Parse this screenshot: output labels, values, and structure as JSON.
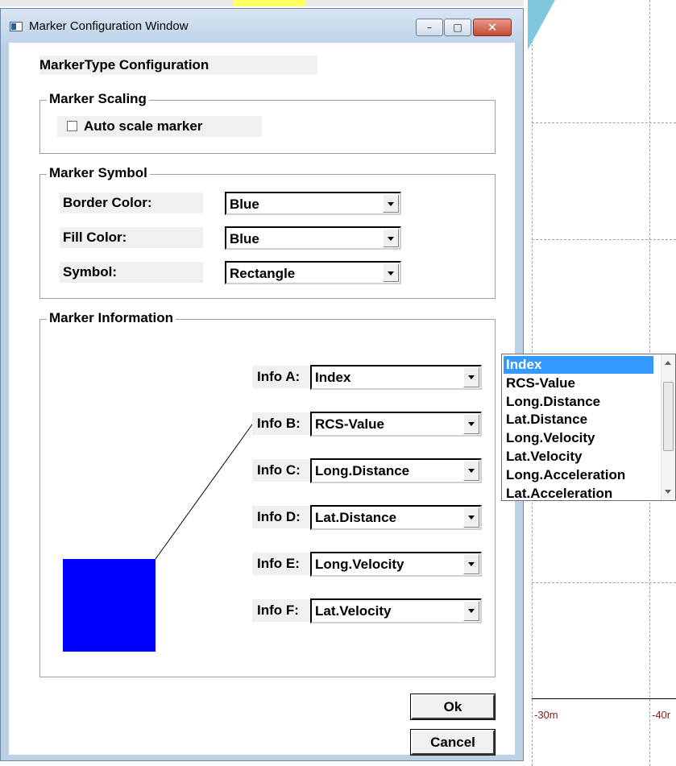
{
  "window": {
    "title": "Marker Configuration Window",
    "heading": "MarkerType Configuration",
    "controls": {
      "minimize": "–",
      "maximize": "□",
      "close": "✕"
    }
  },
  "marker_scaling": {
    "legend": "Marker Scaling",
    "auto_scale_label": "Auto scale marker",
    "auto_scale_checked": false
  },
  "marker_symbol": {
    "legend": "Marker Symbol",
    "border_color_label": "Border Color:",
    "border_color_value": "Blue",
    "fill_color_label": "Fill Color:",
    "fill_color_value": "Blue",
    "symbol_label": "Symbol:",
    "symbol_value": "Rectangle"
  },
  "marker_information": {
    "legend": "Marker Information",
    "preview_color": "#0000ff",
    "infos": [
      {
        "label": "Info A:",
        "value": "Index"
      },
      {
        "label": "Info B:",
        "value": "RCS-Value"
      },
      {
        "label": "Info C:",
        "value": "Long.Distance"
      },
      {
        "label": "Info D:",
        "value": "Lat.Distance"
      },
      {
        "label": "Info E:",
        "value": "Long.Velocity"
      },
      {
        "label": "Info F:",
        "value": "Lat.Velocity"
      }
    ]
  },
  "buttons": {
    "ok": "Ok",
    "cancel": "Cancel"
  },
  "dropdown": {
    "selected": "Index",
    "options": [
      "Index",
      "RCS-Value",
      "Long.Distance",
      "Lat.Distance",
      "Long.Velocity",
      "Lat.Velocity",
      "Long.Acceleration",
      "Lat.Acceleration"
    ]
  },
  "plot": {
    "tick_labels": [
      "-30m",
      "-40r"
    ]
  },
  "colors": {
    "selection": "#3399ff",
    "marker": "#0000ff",
    "tick_text": "#8b1a1a",
    "titlebar": "#bfd3e9",
    "close_button": "#c64a33"
  }
}
